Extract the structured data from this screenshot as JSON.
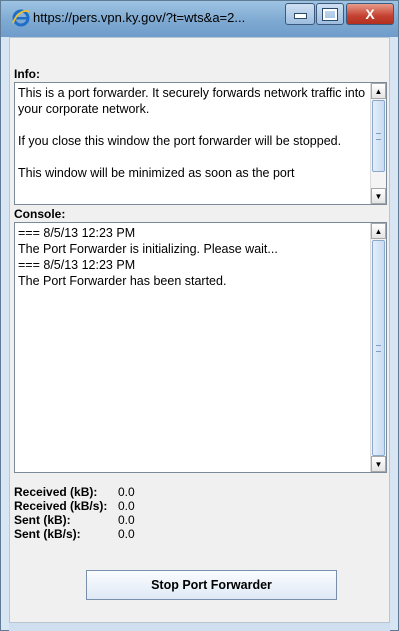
{
  "window": {
    "title": "https://pers.vpn.ky.gov/?t=wts&a=2...",
    "accent": "#7ea9d1",
    "close_color": "#c44131",
    "controls": {
      "minimize": "minimize",
      "maximize": "maximize",
      "close": "X"
    }
  },
  "info": {
    "label": "Info:",
    "paragraphs": [
      "This is a port forwarder. It securely forwards network traffic into your corporate network.",
      "If you close this window the port forwarder will be stopped.",
      "This window will be minimized as soon as the port"
    ]
  },
  "console": {
    "label": "Console:",
    "lines": [
      "=== 8/5/13 12:23 PM",
      "The Port Forwarder is initializing. Please wait...",
      "=== 8/5/13 12:23 PM",
      "The Port Forwarder has been started."
    ]
  },
  "stats": [
    {
      "label": "Received (kB):",
      "value": "0.0"
    },
    {
      "label": "Received (kB/s):",
      "value": "0.0"
    },
    {
      "label": "Sent (kB):",
      "value": "0.0"
    },
    {
      "label": "Sent (kB/s):",
      "value": "0.0"
    }
  ],
  "buttons": {
    "stop": "Stop Port Forwarder"
  },
  "icons": {
    "app": "ie-icon",
    "scroll_up": "arrow-up-icon",
    "scroll_down": "arrow-down-icon"
  }
}
